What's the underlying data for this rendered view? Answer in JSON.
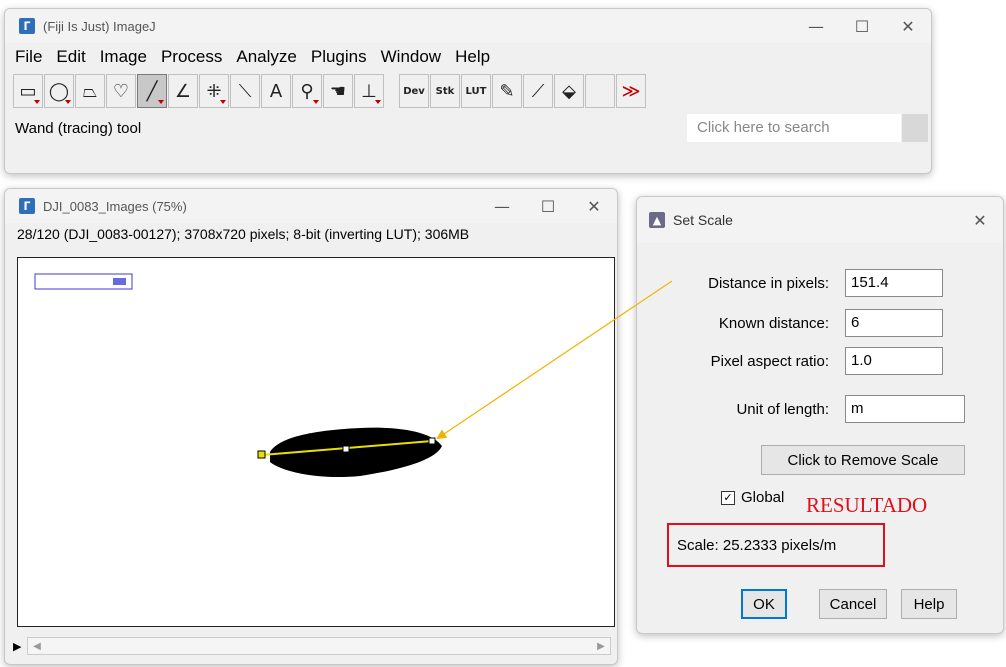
{
  "main_window": {
    "title": "(Fiji Is Just) ImageJ",
    "menu": [
      "File",
      "Edit",
      "Image",
      "Process",
      "Analyze",
      "Plugins",
      "Window",
      "Help"
    ],
    "tools": {
      "dev": "Dev",
      "stk": "Stk",
      "lut": "LUT",
      "text": "A",
      "more": "≫"
    },
    "status": "Wand (tracing) tool",
    "search_placeholder": "Click here to search"
  },
  "image_window": {
    "title": "DJI_0083_Images (75%)",
    "info": "28/120 (DJI_0083-00127); 3708x720 pixels; 8-bit (inverting LUT); 306MB"
  },
  "dialog": {
    "title": "Set Scale",
    "distance_label": "Distance in pixels:",
    "distance_value": "151.4",
    "known_label": "Known distance:",
    "known_value": "6",
    "aspect_label": "Pixel aspect ratio:",
    "aspect_value": "1.0",
    "unit_label": "Unit of length:",
    "unit_value": "m",
    "remove_scale": "Click to Remove Scale",
    "global_label": "Global",
    "global_checked": true,
    "scale_text": "Scale: 25.2333 pixels/m",
    "ok": "OK",
    "cancel": "Cancel",
    "help": "Help"
  },
  "annotation": {
    "resultado": "RESULTADO",
    "color": "#e0101a",
    "arrow_color": "#f0b400"
  },
  "colors": {
    "line_selection": "#e8e000",
    "roi": "#3b3bd8"
  }
}
